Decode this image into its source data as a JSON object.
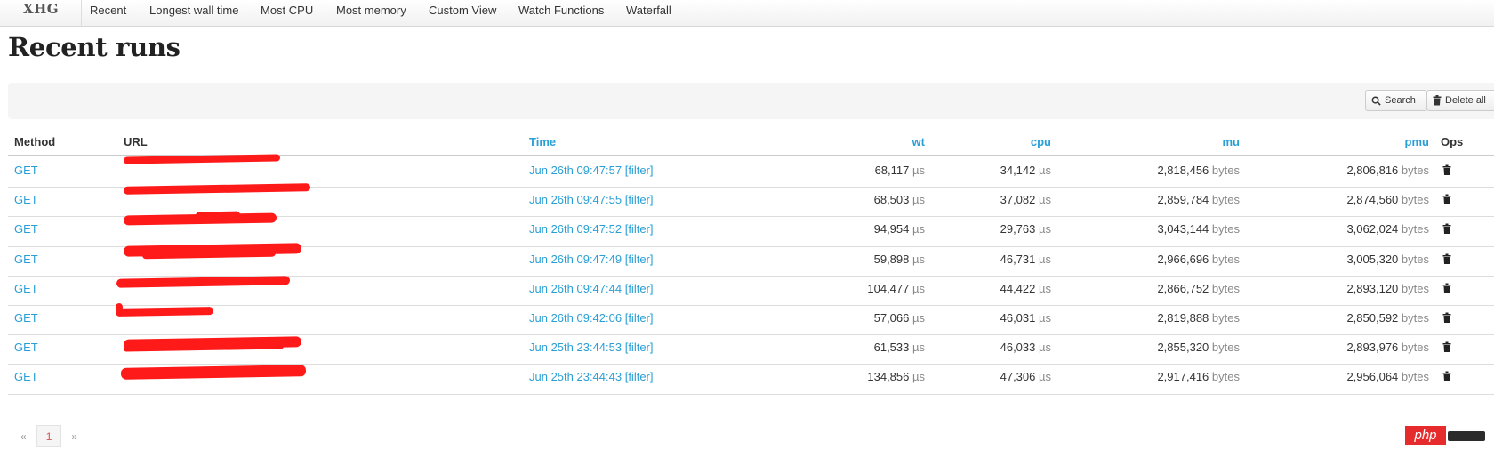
{
  "app": {
    "brand": "XHG"
  },
  "nav": {
    "items": [
      "Recent",
      "Longest wall time",
      "Most CPU",
      "Most memory",
      "Custom View",
      "Watch Functions",
      "Waterfall"
    ]
  },
  "page": {
    "title": "Recent runs"
  },
  "toolbar": {
    "search_label": "Search",
    "delete_all_label": "Delete all"
  },
  "table": {
    "headers": {
      "method": "Method",
      "url": "URL",
      "time": "Time",
      "wt": "wt",
      "cpu": "cpu",
      "mu": "mu",
      "pmu": "pmu",
      "ops": "Ops"
    },
    "units": {
      "time": "µs",
      "bytes": "bytes"
    },
    "rows": [
      {
        "method": "GET",
        "time": "Jun 26th 09:47:57 [filter]",
        "wt": "68,117",
        "cpu": "34,142",
        "mu": "2,818,456",
        "pmu": "2,806,816"
      },
      {
        "method": "GET",
        "time": "Jun 26th 09:47:55 [filter]",
        "wt": "68,503",
        "cpu": "37,082",
        "mu": "2,859,784",
        "pmu": "2,874,560"
      },
      {
        "method": "GET",
        "time": "Jun 26th 09:47:52 [filter]",
        "wt": "94,954",
        "cpu": "29,763",
        "mu": "3,043,144",
        "pmu": "3,062,024"
      },
      {
        "method": "GET",
        "time": "Jun 26th 09:47:49 [filter]",
        "wt": "59,898",
        "cpu": "46,731",
        "mu": "2,966,696",
        "pmu": "3,005,320"
      },
      {
        "method": "GET",
        "time": "Jun 26th 09:47:44 [filter]",
        "wt": "104,477",
        "cpu": "44,422",
        "mu": "2,866,752",
        "pmu": "2,893,120"
      },
      {
        "method": "GET",
        "time": "Jun 26th 09:42:06 [filter]",
        "wt": "57,066",
        "cpu": "46,031",
        "mu": "2,819,888",
        "pmu": "2,850,592"
      },
      {
        "method": "GET",
        "time": "Jun 25th 23:44:53 [filter]",
        "wt": "61,533",
        "cpu": "46,033",
        "mu": "2,855,320",
        "pmu": "2,893,976"
      },
      {
        "method": "GET",
        "time": "Jun 25th 23:44:43 [filter]",
        "wt": "134,856",
        "cpu": "47,306",
        "mu": "2,917,416",
        "pmu": "2,956,064"
      }
    ]
  },
  "pagination": {
    "prev": "«",
    "current": "1",
    "next": "»"
  },
  "watermark": {
    "text": "php"
  },
  "colors": {
    "link": "#2a9fd6",
    "redaction": "#ff1a1a",
    "active_page": "#d9534f",
    "watermark": "#e52b2b"
  },
  "icons": {
    "search": "search-icon",
    "trash": "trash-icon"
  }
}
